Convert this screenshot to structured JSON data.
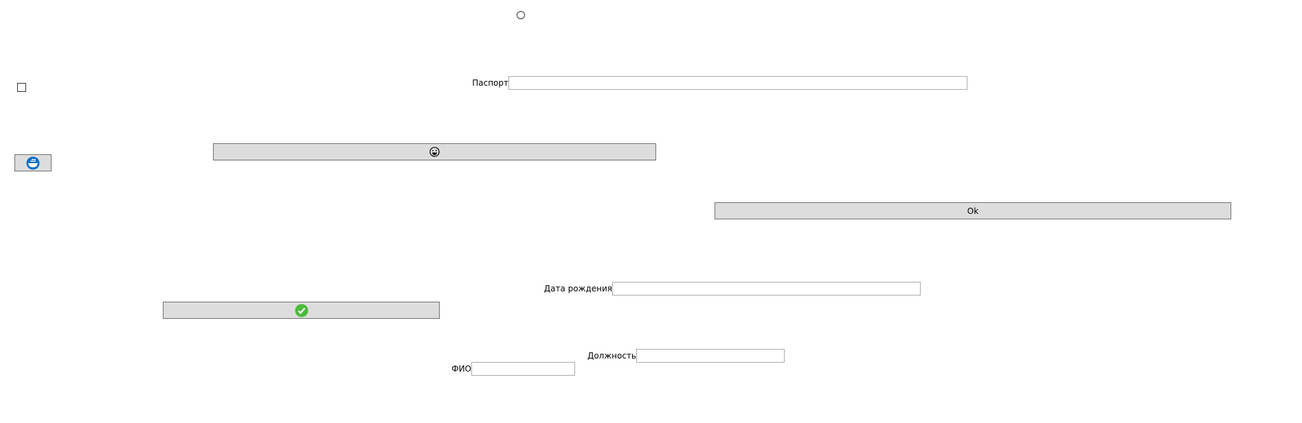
{
  "radio": {
    "checked": false
  },
  "checkbox": {
    "checked": false
  },
  "passport": {
    "label": "Паспорт",
    "value": ""
  },
  "emoji_button": {
    "icon": "grinning-face-icon"
  },
  "blue_icon_button": {
    "icon": "blue-circle-icon",
    "color": "#0a6fc8"
  },
  "ok_button": {
    "label": "Ok"
  },
  "birth_date": {
    "label": "Дата рождения",
    "value": ""
  },
  "check_button": {
    "icon": "green-check-icon",
    "color": "#4cba3c"
  },
  "position": {
    "label": "Должность",
    "value": ""
  },
  "fio": {
    "label": "ФИО",
    "value": ""
  }
}
